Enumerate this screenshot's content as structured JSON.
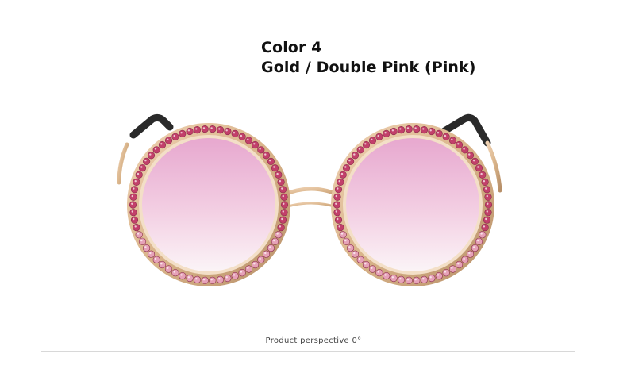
{
  "heading": {
    "color_label": "Color 4",
    "color_name": "Gold / Double Pink (Pink)"
  },
  "product": {
    "name": "round rhinestone sunglasses",
    "frame_color": "#d9b48a",
    "stone_color_outer": "#c2406a",
    "stone_color_inner": "#e6a2b8",
    "lens_top": "#e7a8cf",
    "lens_bottom": "#fbf4f7",
    "temple_tip_color": "#2a2a2a"
  },
  "caption": {
    "text": "Product perspective 0°"
  }
}
